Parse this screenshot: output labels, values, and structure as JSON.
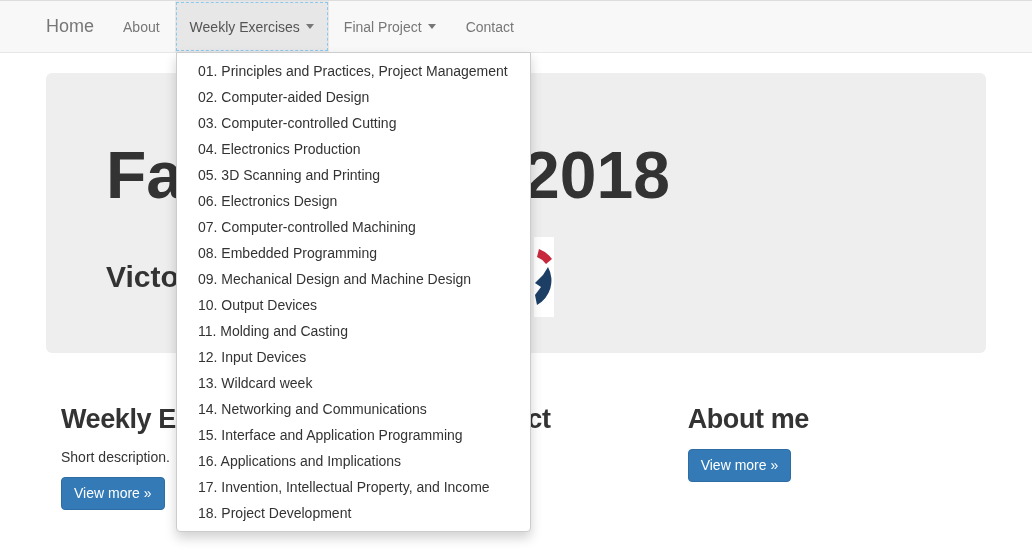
{
  "navbar": {
    "brand": "Home",
    "items": [
      {
        "label": "About",
        "selected": false,
        "dropdown": false
      },
      {
        "label": "Weekly Exercises",
        "selected": true,
        "dropdown": true
      },
      {
        "label": "Final Project",
        "selected": false,
        "dropdown": true
      },
      {
        "label": "Contact",
        "selected": false,
        "dropdown": false
      }
    ]
  },
  "dropdown_menu": {
    "items": [
      "01. Principles and Practices, Project Management",
      "02. Computer-aided Design",
      "03. Computer-controlled Cutting",
      "04. Electronics Production",
      "05. 3D Scanning and Printing",
      "06. Electronics Design",
      "07. Computer-controlled Machining",
      "08. Embedded Programming",
      "09. Mechanical Design and Machine Design",
      "10. Output Devices",
      "11. Molding and Casting",
      "12. Input Devices",
      "13. Wildcard week",
      "14. Networking and Communications",
      "15. Interface and Application Programming",
      "16. Applications and Implications",
      "17. Invention, Intellectual Property, and Income",
      "18. Project Development"
    ]
  },
  "jumbotron": {
    "title_parts": [
      "Fa",
      "2018"
    ],
    "subtitle": "Victo"
  },
  "columns": [
    {
      "heading": "Weekly E",
      "text": "Short description.",
      "button": "View more »"
    },
    {
      "heading": "ct"
    },
    {
      "heading": "About me",
      "button": "View more »"
    }
  ]
}
